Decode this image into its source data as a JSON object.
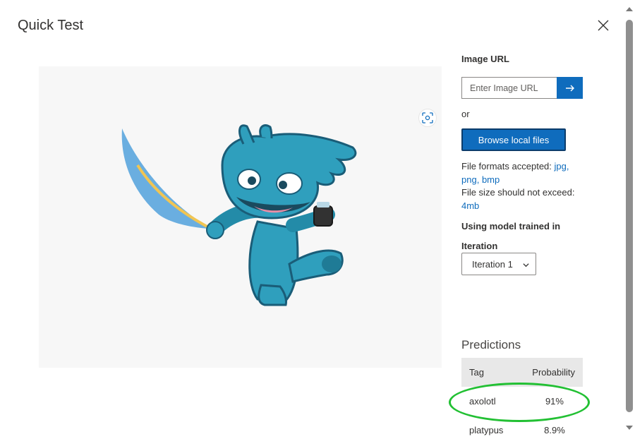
{
  "dialog": {
    "title": "Quick Test"
  },
  "image_panel": {
    "icons": {
      "focus": "image-focus-icon",
      "mascot": "axolotl-mascot-image"
    }
  },
  "side_panel": {
    "image_url_label": "Image URL",
    "image_url_placeholder": "Enter Image URL",
    "image_url_value": "",
    "or_text": "or",
    "browse_label": "Browse local files",
    "formats_text": "File formats accepted: ",
    "formats": [
      "jpg",
      "png",
      "bmp"
    ],
    "size_text": "File size should not exceed: ",
    "size_limit": "4mb",
    "model_label": "Using model trained in",
    "iteration_label": "Iteration",
    "iteration_selected": "Iteration 1"
  },
  "predictions": {
    "title": "Predictions",
    "columns": [
      "Tag",
      "Probability"
    ],
    "rows": [
      {
        "tag": "axolotl",
        "probability": "91%"
      },
      {
        "tag": "platypus",
        "probability": "8.9%"
      }
    ]
  },
  "colors": {
    "accent": "#0f6cbd",
    "highlight": "#22c033",
    "preview_bg": "#f7f7f7",
    "table_header": "#e8e8e8"
  }
}
